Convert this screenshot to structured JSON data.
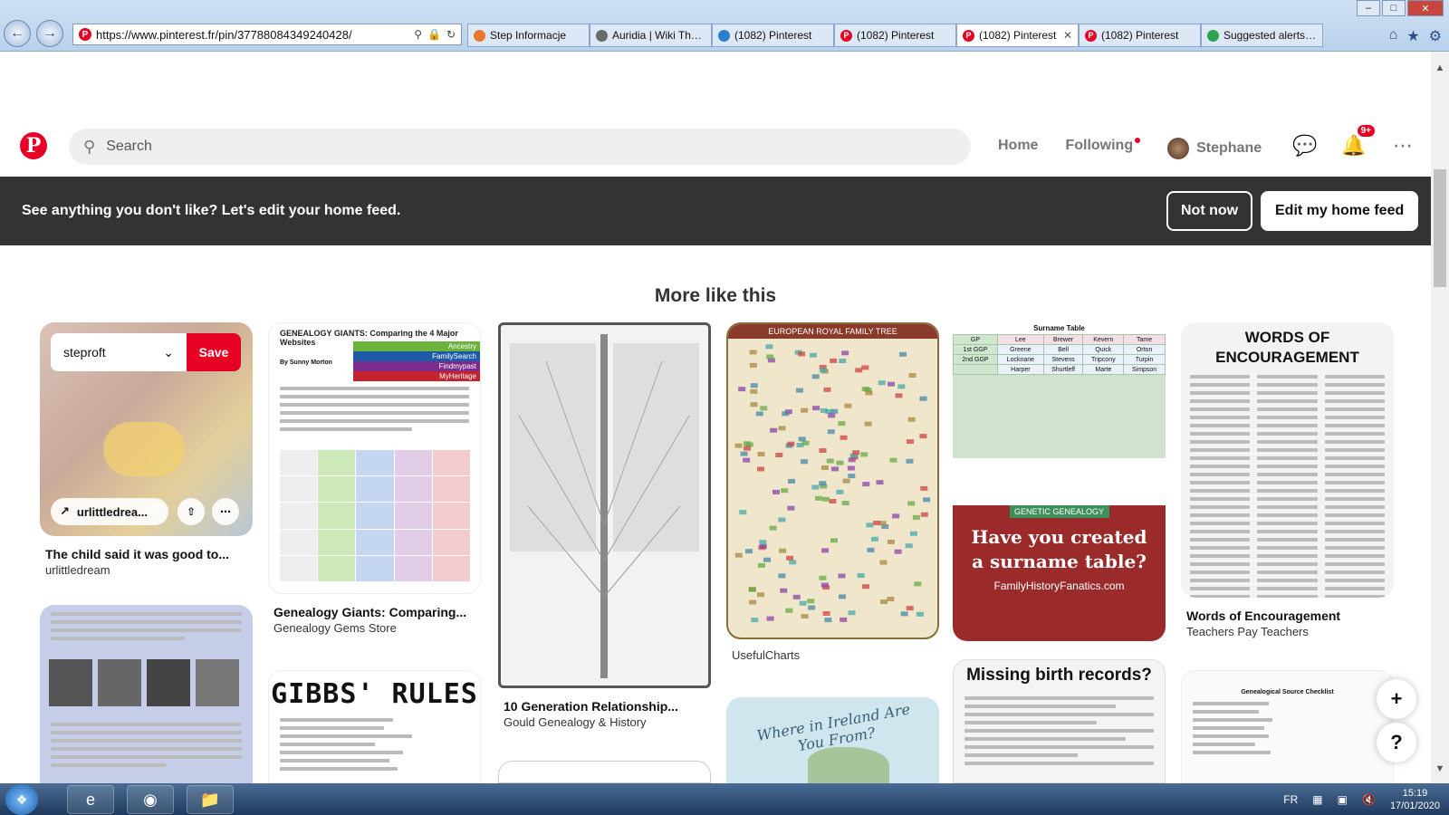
{
  "browser": {
    "url": "https://www.pinterest.fr/pin/37788084349240428/",
    "tabs": [
      {
        "label": "Step Informacje",
        "icon_color": "#e8772e"
      },
      {
        "label": "Auridia | Wiki The E...",
        "icon_color": "#6a6a6a"
      },
      {
        "label": "(1082) Pinterest",
        "icon_color": "#2a7fd1"
      },
      {
        "label": "(1082) Pinterest",
        "icon_color": "#e60023"
      },
      {
        "label": "(1082) Pinterest",
        "icon_color": "#e60023",
        "active": true
      },
      {
        "label": "(1082) Pinterest",
        "icon_color": "#e60023"
      },
      {
        "label": "Suggested alerts - ...",
        "icon_color": "#2ea44f"
      }
    ]
  },
  "header": {
    "search_placeholder": "Search",
    "nav_home": "Home",
    "nav_following": "Following",
    "user_name": "Stephane",
    "notification_count": "9+"
  },
  "banner": {
    "text": "See anything you don't like? Let's edit your home feed.",
    "not_now": "Not now",
    "edit_feed": "Edit my home feed"
  },
  "feed": {
    "section_title": "More like this",
    "pins": [
      {
        "title": "The child said it was good to...",
        "source": "urlittledream",
        "board": "steproft",
        "save": "Save",
        "link": "urlittledrea..."
      },
      {
        "title": "Genealogy Giants: Comparing...",
        "source": "Genealogy Gems Store",
        "heading": "GENEALOGY GIANTS: Comparing the 4 Major Websites",
        "sites": [
          "Ancestry",
          "FamilySearch",
          "Findmypast",
          "MyHeritage"
        ],
        "author": "By Sunny Morton"
      },
      {
        "title": "10 Generation Relationship...",
        "source": "Gould Genealogy & History"
      },
      {
        "title": "",
        "source": "UsefulCharts",
        "heading": "EUROPEAN ROYAL FAMILY TREE"
      },
      {
        "heading": "Surname Table",
        "banner": "GENETIC GENEALOGY",
        "big_text": "Have you created a surname table?",
        "site": "FamilyHistoryFanatics.com",
        "rows": [
          [
            "GP",
            "Lee",
            "Brewer",
            "Kevern",
            "Tame"
          ],
          [
            "1st GGP",
            "Greene",
            "Bell",
            "Quick",
            "Orton"
          ],
          [
            "2nd GGP",
            "Locknane",
            "Stevens",
            "Tripcony",
            "Turpin"
          ],
          [
            "",
            "Harper",
            "Shurtleff",
            "Marte",
            "Simpson"
          ]
        ]
      },
      {
        "title": "Words of Encouragement",
        "source": "Teachers Pay Teachers",
        "heading": "WORDS OF ENCOURAGEMENT"
      },
      {
        "heading": "GIBBS' RULES"
      },
      {
        "heading": "Where in Ireland Are You From?"
      },
      {
        "heading": "Missing birth records?"
      },
      {
        "heading": "Genealogical Source Checklist"
      }
    ]
  },
  "floating": {
    "add": "+",
    "help": "?"
  },
  "taskbar": {
    "lang": "FR",
    "time": "15:19",
    "date": "17/01/2020"
  }
}
